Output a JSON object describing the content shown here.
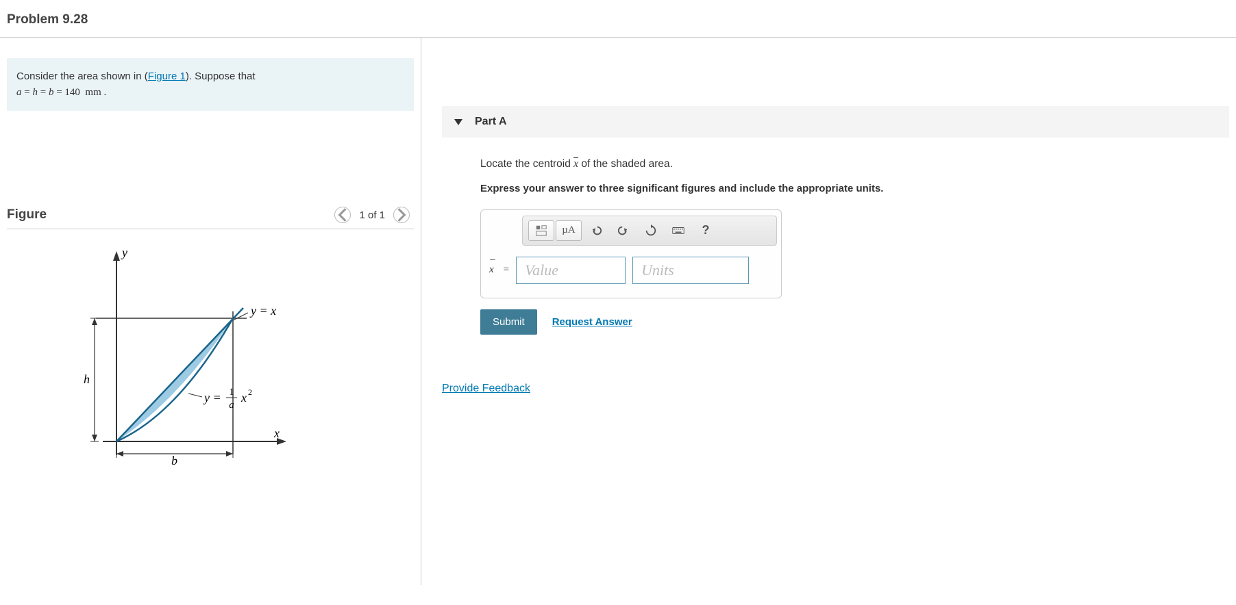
{
  "header": {
    "title": "Problem 9.28"
  },
  "info": {
    "prefix": "Consider the area shown in (",
    "figure_link": "Figure 1",
    "suffix": "). Suppose that",
    "equation_html": "a = h = b = 140  mm ."
  },
  "figure": {
    "title": "Figure",
    "nav_label": "1 of 1",
    "labels": {
      "y_axis": "y",
      "x_axis": "x",
      "h": "h",
      "b": "b",
      "curve1": "y = x",
      "curve2_before": "y =",
      "curve2_num": "1",
      "curve2_den": "a",
      "curve2_after": "x",
      "curve2_sup": "2"
    }
  },
  "part": {
    "label": "Part A",
    "question_prefix": "Locate the centroid ",
    "question_var": "x̄",
    "question_suffix": " of the shaded area.",
    "instruction": "Express your answer to three significant figures and include the appropriate units.",
    "answer": {
      "var_label": "x",
      "eq": "=",
      "value_placeholder": "Value",
      "units_placeholder": "Units"
    },
    "toolbar": {
      "template": "template-icon",
      "greek": "µA",
      "undo": "undo-icon",
      "redo": "redo-icon",
      "reset": "reset-icon",
      "keyboard": "keyboard-icon",
      "help": "?"
    },
    "submit_label": "Submit",
    "request_label": "Request Answer"
  },
  "feedback_label": "Provide Feedback"
}
